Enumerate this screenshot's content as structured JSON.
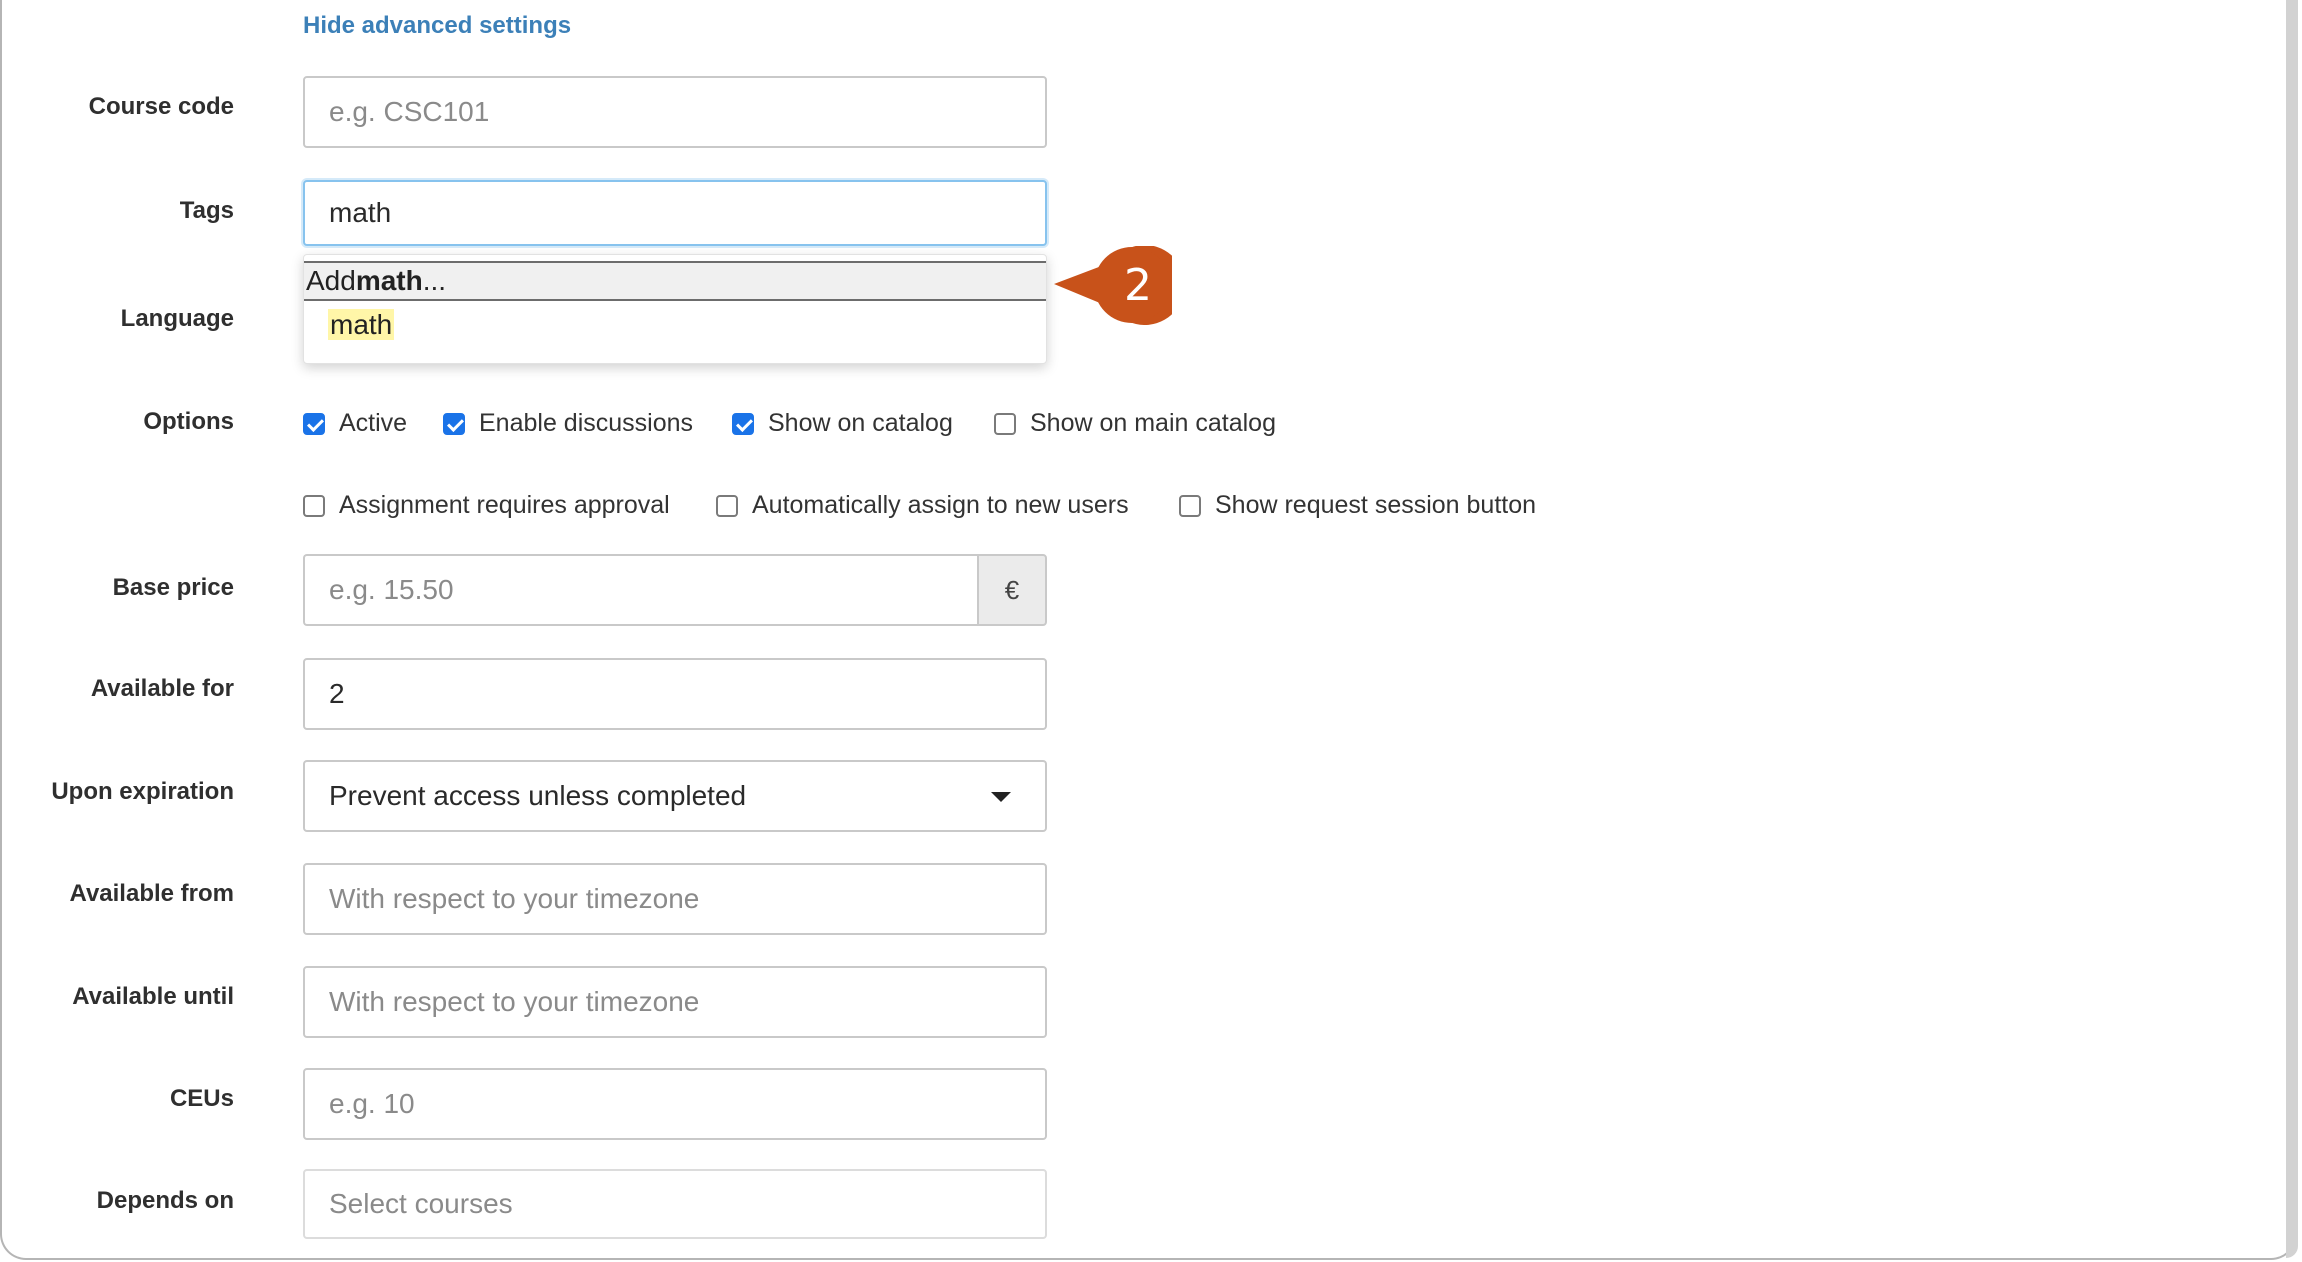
{
  "advanced_toggle": "Hide advanced settings",
  "fields": {
    "course_code": {
      "label": "Course code",
      "placeholder": "e.g. CSC101"
    },
    "tags": {
      "label": "Tags",
      "value": "math"
    },
    "language": {
      "label": "Language"
    },
    "options": {
      "label": "Options",
      "checkboxes": [
        {
          "label": "Active",
          "checked": true
        },
        {
          "label": "Enable discussions",
          "checked": true
        },
        {
          "label": "Show on catalog",
          "checked": true
        },
        {
          "label": "Show on main catalog",
          "checked": false
        },
        {
          "label": "Assignment requires approval",
          "checked": false
        },
        {
          "label": "Automatically assign to new users",
          "checked": false
        },
        {
          "label": "Show request session button",
          "checked": false
        }
      ]
    },
    "base_price": {
      "label": "Base price",
      "placeholder": "e.g. 15.50",
      "currency": "€"
    },
    "available_for": {
      "label": "Available for",
      "value": "2"
    },
    "upon_expiration": {
      "label": "Upon expiration",
      "selected": "Prevent access unless completed"
    },
    "available_from": {
      "label": "Available from",
      "placeholder": "With respect to your timezone"
    },
    "available_until": {
      "label": "Available until",
      "placeholder": "With respect to your timezone"
    },
    "ceus": {
      "label": "CEUs",
      "placeholder": "e.g. 10"
    },
    "depends_on": {
      "label": "Depends on",
      "placeholder": "Select courses"
    }
  },
  "tags_dropdown": {
    "add_prefix": "Add ",
    "add_term": "math",
    "add_suffix": "...",
    "suggestion": "math"
  },
  "callout": {
    "number": "2",
    "color": "#c8521a"
  },
  "colors": {
    "link": "#3c80b8",
    "checkbox": "#1a73e8",
    "focus_border": "#87c3ee",
    "highlight": "#fff6a8"
  }
}
